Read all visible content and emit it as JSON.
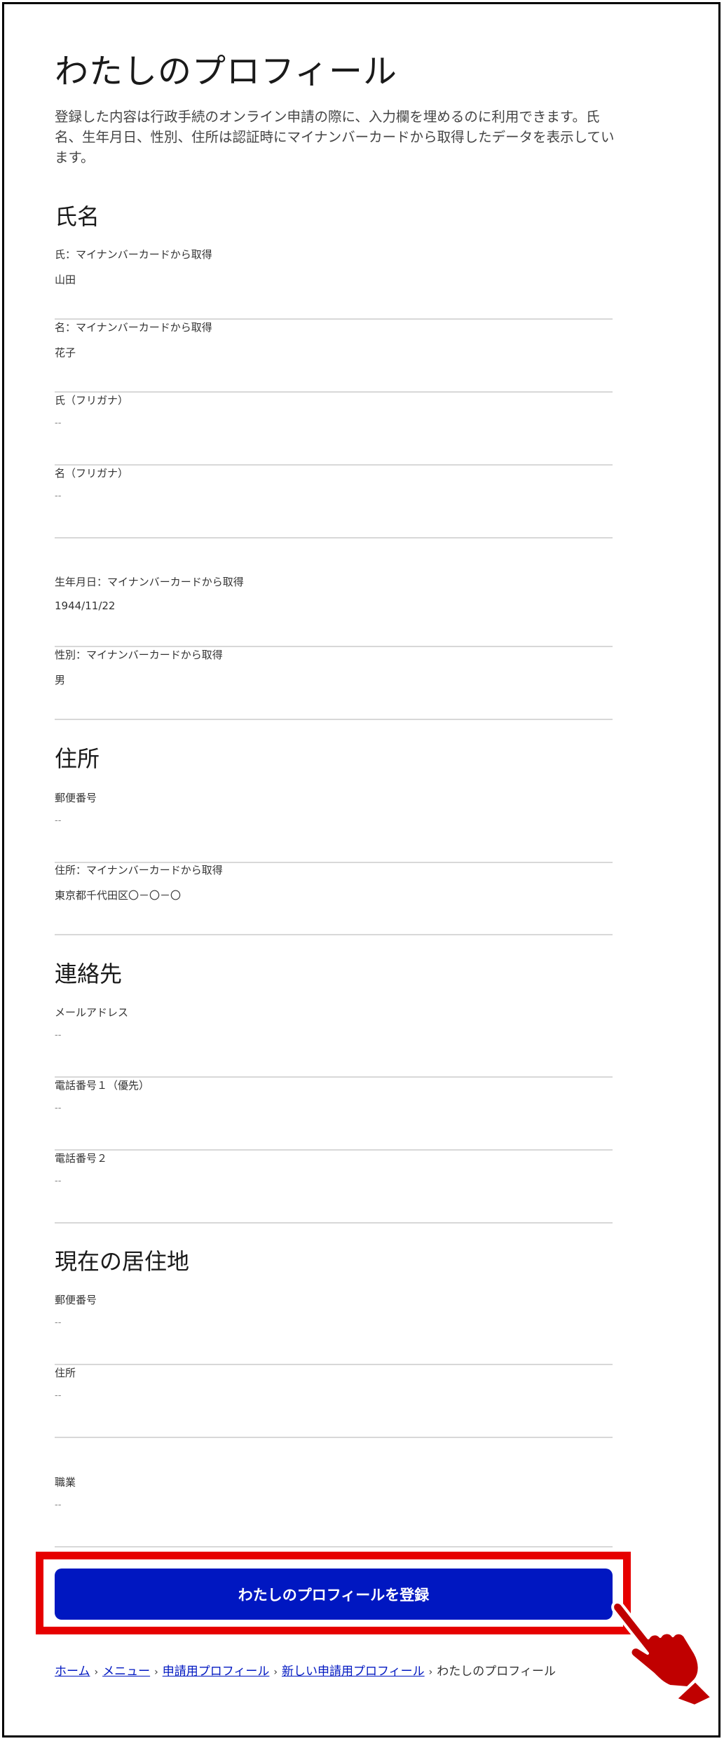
{
  "page": {
    "title": "わたしのプロフィール",
    "description": "登録した内容は行政手続のオンライン申請の際に、入力欄を埋めるのに利用できます。氏名、生年月日、性別、住所は認証時にマイナンバーカードから取得したデータを表示しています。"
  },
  "sections": {
    "name": {
      "title": "氏名",
      "fields": [
        {
          "label": "氏：マイナンバーカードから取得",
          "value": "山田"
        },
        {
          "label": "名：マイナンバーカードから取得",
          "value": "花子"
        },
        {
          "label": "氏（フリガナ）",
          "value": "--"
        },
        {
          "label": "名（フリガナ）",
          "value": "--"
        }
      ]
    },
    "personal": {
      "fields": [
        {
          "label": "生年月日：マイナンバーカードから取得",
          "value": "1944/11/22"
        },
        {
          "label": "性別：マイナンバーカードから取得",
          "value": "男"
        }
      ]
    },
    "address": {
      "title": "住所",
      "fields": [
        {
          "label": "郵便番号",
          "value": "--"
        },
        {
          "label": "住所：マイナンバーカードから取得",
          "value": "東京都千代田区〇－〇－〇"
        }
      ]
    },
    "contact": {
      "title": "連絡先",
      "fields": [
        {
          "label": "メールアドレス",
          "value": "--"
        },
        {
          "label": "電話番号１（優先）",
          "value": "--"
        },
        {
          "label": "電話番号２",
          "value": "--"
        }
      ]
    },
    "residence": {
      "title": "現在の居住地",
      "fields": [
        {
          "label": "郵便番号",
          "value": "--"
        },
        {
          "label": "住所",
          "value": "--"
        }
      ]
    },
    "occupation": {
      "fields": [
        {
          "label": "職業",
          "value": "--"
        }
      ]
    }
  },
  "actions": {
    "register_label": "わたしのプロフィールを登録"
  },
  "breadcrumb": {
    "items": [
      "ホーム",
      "メニュー",
      "申請用プロフィール",
      "新しい申請用プロフィール"
    ],
    "separator": "›",
    "current": "わたしのプロフィール"
  },
  "colors": {
    "accent": "#0017c1",
    "highlight": "#e60000",
    "hand": "#c00000"
  }
}
